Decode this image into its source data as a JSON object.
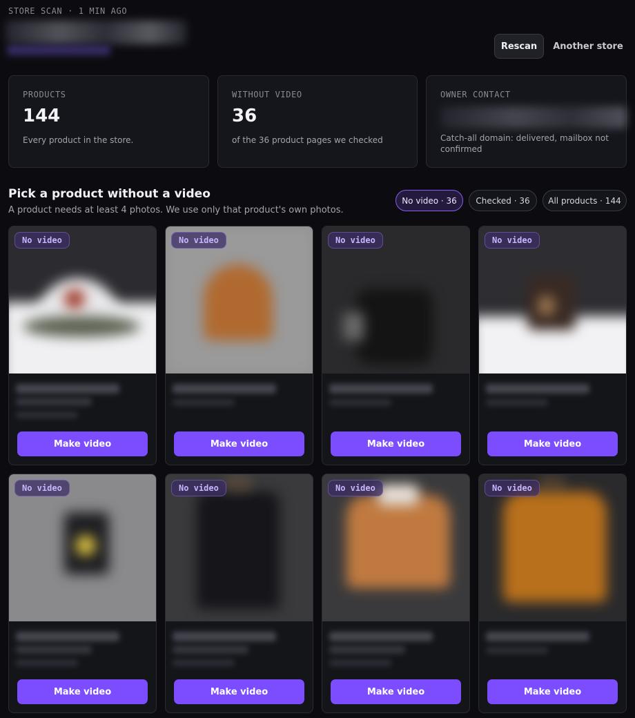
{
  "header": {
    "eyebrow": "STORE SCAN · 1 MIN AGO",
    "rescan_label": "Rescan",
    "another_store_label": "Another store"
  },
  "stats": {
    "products": {
      "label": "PRODUCTS",
      "value": "144",
      "desc": "Every product in the store."
    },
    "without_video": {
      "label": "WITHOUT VIDEO",
      "value": "36",
      "desc": "of the 36 product pages we checked"
    },
    "owner_contact": {
      "label": "OWNER CONTACT",
      "desc": "Catch-all domain: delivered, mailbox not confirmed"
    }
  },
  "section": {
    "title": "Pick a product without a video",
    "subtitle": "A product needs at least 4 photos. We use only that product's own photos."
  },
  "filters": [
    {
      "label": "No video · 36",
      "active": true
    },
    {
      "label": "Checked · 36",
      "active": false
    },
    {
      "label": "All products · 144",
      "active": false
    }
  ],
  "products": [
    {
      "badge": "No video",
      "button": "Make video",
      "image": "white-cap"
    },
    {
      "badge": "No video",
      "button": "Make video",
      "image": "orange-beanie"
    },
    {
      "badge": "No video",
      "button": "Make video",
      "image": "black-item"
    },
    {
      "badge": "No video",
      "button": "Make video",
      "image": "brown-mug"
    },
    {
      "badge": "No video",
      "button": "Make video",
      "image": "phone-case"
    },
    {
      "badge": "No video",
      "button": "Make video",
      "image": "black-tshirt"
    },
    {
      "badge": "No video",
      "button": "Make video",
      "image": "orange-sweatshirt"
    },
    {
      "badge": "No video",
      "button": "Make video",
      "image": "orange-hoodie"
    }
  ],
  "colors": {
    "accent": "#7c4dff",
    "background": "#0c0c10",
    "card": "#141519",
    "badge_text": "#c9b6ff"
  }
}
